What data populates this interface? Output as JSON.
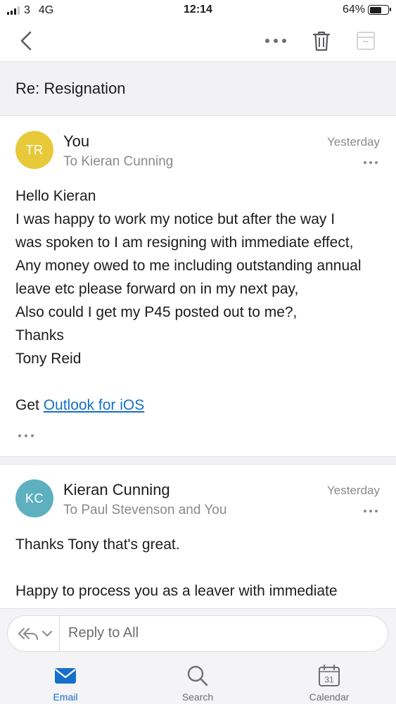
{
  "status_bar": {
    "carrier": "3",
    "network": "4G",
    "time": "12:14",
    "battery": "64%",
    "battery_level": 0.64
  },
  "thread": {
    "subject": "Re: Resignation"
  },
  "messages": [
    {
      "avatar_initials": "TR",
      "avatar_color": "#e8c93a",
      "sender": "You",
      "recipients": "To Kieran Cunning",
      "date": "Yesterday",
      "body_lines": [
        "Hello Kieran",
        "I was happy to work my notice but after the way I",
        "was spoken to I am resigning with immediate effect,",
        "Any money owed to me including outstanding annual",
        "leave etc please forward on in my next pay,",
        "Also could I get my P45 posted out to me?,",
        "Thanks",
        "Tony Reid"
      ],
      "signature_prefix": "Get ",
      "signature_link": "Outlook for iOS"
    },
    {
      "avatar_initials": "KC",
      "avatar_color": "#5fb0bf",
      "sender": "Kieran Cunning",
      "recipients": "To Paul Stevenson and You",
      "date": "Yesterday",
      "body_lines": [
        "Thanks Tony that's great.",
        "",
        "Happy to process you as a leaver with immediate"
      ]
    }
  ],
  "reply": {
    "placeholder": "Reply to All"
  },
  "tabs": [
    {
      "label": "Email",
      "icon": "mail-icon",
      "active": true
    },
    {
      "label": "Search",
      "icon": "search-icon",
      "active": false
    },
    {
      "label": "Calendar",
      "icon": "calendar-icon",
      "active": false,
      "calendar_day": "31"
    }
  ],
  "colors": {
    "accent": "#1570c9",
    "secondary_text": "#8a8a8e"
  }
}
